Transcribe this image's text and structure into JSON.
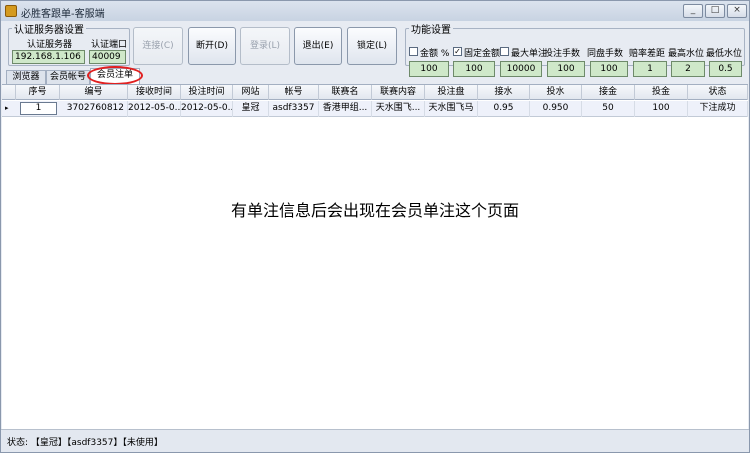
{
  "window": {
    "title": "必胜客跟单-客服端",
    "controls": [
      "_",
      "□",
      "×"
    ]
  },
  "auth": {
    "legend": "认证服务器设置",
    "server_label": "认证服务器",
    "port_label": "认证端口",
    "server_value": "192.168.1.106",
    "port_value": "40009"
  },
  "toolbar": {
    "connect": "连接(C)",
    "disconnect": "断开(D)",
    "login": "登录(L)",
    "exit": "退出(E)",
    "lock": "锁定(L)"
  },
  "functions": {
    "legend": "功能设置",
    "items": [
      {
        "label": "金额 %",
        "checked": false,
        "value": "100"
      },
      {
        "label": "固定金额",
        "checked": true,
        "value": "100"
      },
      {
        "label": "最大单注",
        "checked": false,
        "value": "10000"
      },
      {
        "label": "投注手数",
        "value": "100"
      },
      {
        "label": "同盘手数",
        "value": "100"
      },
      {
        "label": "赔率差距",
        "value": "1"
      },
      {
        "label": "最高水位",
        "value": "2"
      },
      {
        "label": "最低水位",
        "value": "0.5"
      }
    ]
  },
  "tabs": [
    "浏览器",
    "会员帐号",
    "会员注单"
  ],
  "grid": {
    "columns": [
      "序号",
      "编号",
      "接收时间",
      "投注时间",
      "网站",
      "帐号",
      "联赛名",
      "联赛内容",
      "投注盘",
      "接水",
      "投水",
      "接金",
      "投金",
      "状态"
    ],
    "rows": [
      [
        "1",
        "3702760812",
        "2012-05-0...",
        "2012-05-0...",
        "皇冠",
        "asdf3357",
        "香港甲组...",
        "天水围飞...",
        "天水围飞马",
        "0.95",
        "0.950",
        "50",
        "100",
        "下注成功"
      ]
    ],
    "row_marker": "▸"
  },
  "note": "有单注信息后会出现在会员单注这个页面",
  "status": {
    "text": "状态: 【皇冠】【asdf3357】【未使用】"
  }
}
